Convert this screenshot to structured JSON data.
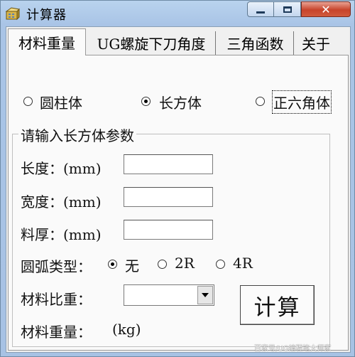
{
  "window": {
    "title": "计算器",
    "icon": "calculator-app-icon",
    "controls": {
      "minimize": "minimize-icon",
      "maximize": "maximize-icon",
      "close": "✕"
    }
  },
  "tabs": [
    {
      "label": "材料重量",
      "active": true
    },
    {
      "label": "UG螺旋下刀角度",
      "active": false
    },
    {
      "label": "三角函数",
      "active": false
    },
    {
      "label": "关于",
      "active": false
    }
  ],
  "shape_options": [
    {
      "label": "圆柱体",
      "selected": false
    },
    {
      "label": "长方体",
      "selected": true
    },
    {
      "label": "正六角体",
      "selected": false
    }
  ],
  "group": {
    "title": "请输入长方体参数",
    "length_label": "长度：(mm)",
    "length_value": "",
    "width_label": "宽度：(mm)",
    "width_value": "",
    "thickness_label": "料厚：(mm)",
    "thickness_value": "",
    "arc_type_label": "圆弧类型：",
    "arc_options": [
      {
        "label": "无",
        "selected": true
      },
      {
        "label": "2R",
        "selected": false
      },
      {
        "label": "4R",
        "selected": false
      }
    ],
    "density_label": "材料比重：",
    "density_value": "",
    "calc_button": "计算",
    "weight_label": "材料重量：",
    "weight_unit": "(kg)"
  },
  "watermark": "百家号/UG编程笔大师家"
}
